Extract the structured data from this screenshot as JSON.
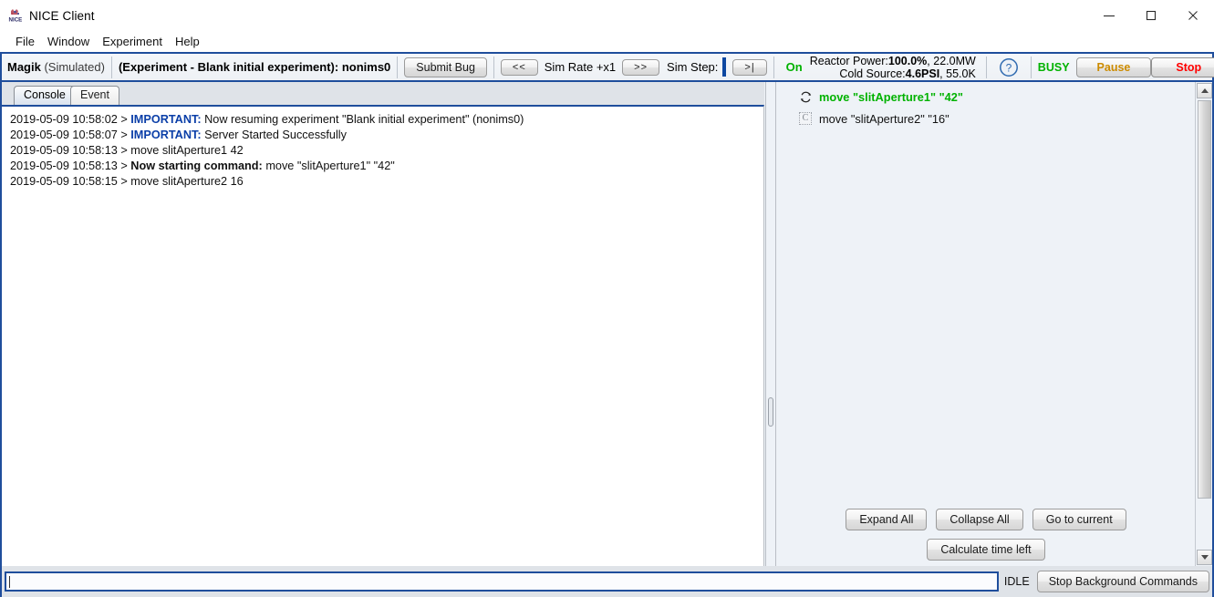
{
  "window": {
    "title": "NICE Client",
    "icon": "nice-logo-icon",
    "controls": {
      "minimize": "minimize-icon",
      "maximize": "maximize-icon",
      "close": "close-icon"
    }
  },
  "menubar": {
    "items": [
      {
        "label": "File"
      },
      {
        "label": "Window"
      },
      {
        "label": "Experiment"
      },
      {
        "label": "Help"
      }
    ]
  },
  "toolbar": {
    "instrument_name": "Magik",
    "instrument_mode": "(Simulated)",
    "experiment": "(Experiment - Blank initial experiment): nonims0",
    "submit_bug_label": "Submit Bug",
    "sim_rate_back_label": "<<",
    "sim_rate_label": "Sim Rate +x1",
    "sim_rate_forward_label": ">>",
    "sim_step_label": "Sim Step:",
    "sim_step_value": "",
    "sim_step_next_label": ">|",
    "on_status": "On",
    "reactor_power_label": "Reactor Power:",
    "reactor_power_value": "100.0%",
    "reactor_power_extra": ", 22.0MW",
    "cold_source_label": "Cold Source:",
    "cold_source_value": "4.6PSI",
    "cold_source_extra": ", 55.0K",
    "help_icon": "help-icon",
    "busy_status": "BUSY",
    "pause_label": "Pause",
    "stop_label": "Stop",
    "colors": {
      "on": "#00b200",
      "busy": "#00b200",
      "pause": "#cc8b00",
      "stop": "#ff0000",
      "frame": "#1f4e9c"
    }
  },
  "left_panel": {
    "tabs": [
      {
        "label": "Console",
        "active": true
      },
      {
        "label": "Event",
        "active": false
      }
    ],
    "log": [
      {
        "timestamp": "2019-05-09 10:58:02 >",
        "tag": "IMPORTANT:",
        "message": "Now resuming experiment \"Blank initial experiment\" (nonims0)"
      },
      {
        "timestamp": "2019-05-09 10:58:07 >",
        "tag": "IMPORTANT:",
        "message": "Server Started Successfully"
      },
      {
        "timestamp": "2019-05-09 10:58:13 >",
        "tag": "",
        "message": "move slitAperture1 42"
      },
      {
        "timestamp": "2019-05-09 10:58:13 >",
        "tag_bold": "Now starting command:",
        "message": "move \"slitAperture1\" \"42\""
      },
      {
        "timestamp": "2019-05-09 10:58:15 >",
        "tag": "",
        "message": "move slitAperture2 16"
      }
    ]
  },
  "right_panel": {
    "queue": [
      {
        "icon": "running-circular-arrows-icon",
        "label": "move \"slitAperture1\" \"42\"",
        "state": "current"
      },
      {
        "icon": "command-c-icon",
        "label": "move \"slitAperture2\" \"16\"",
        "state": "pending"
      }
    ],
    "buttons_row1": [
      {
        "label": "Expand All"
      },
      {
        "label": "Collapse All"
      },
      {
        "label": "Go to current"
      }
    ],
    "buttons_row2": [
      {
        "label": "Calculate time left"
      }
    ],
    "scrollbar": {
      "up_icon": "scroll-up-arrow-icon",
      "down_icon": "scroll-down-arrow-icon"
    }
  },
  "statusbar": {
    "command_input_value": "",
    "state_label": "IDLE",
    "stop_background_label": "Stop Background Commands"
  }
}
